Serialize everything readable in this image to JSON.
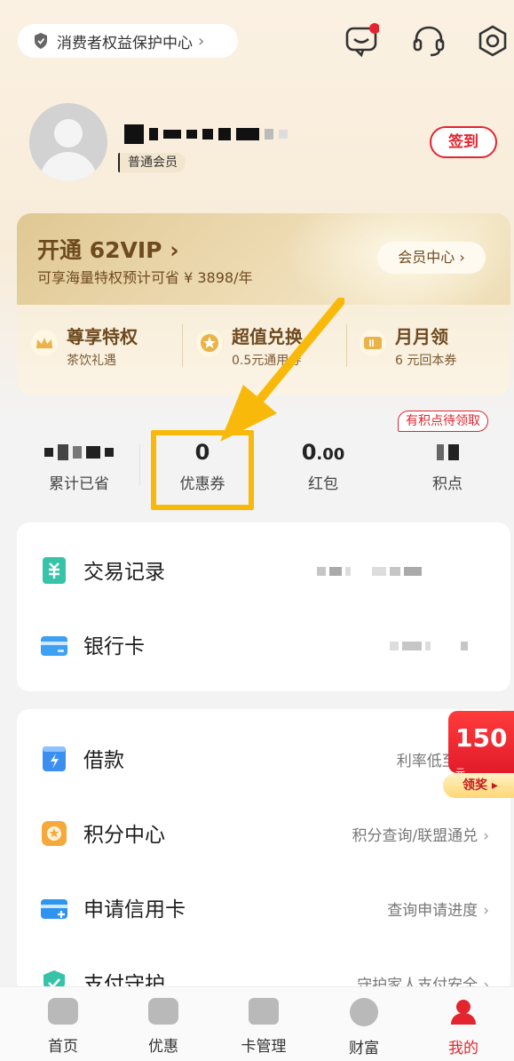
{
  "header": {
    "consumer_label": "消费者权益保护中心",
    "chevron": "›",
    "icons": [
      "message-icon",
      "headset-icon",
      "settings-icon"
    ],
    "notification_dot_color": "#e3252f"
  },
  "profile": {
    "member_level": "普通会员",
    "checkin_label": "签到"
  },
  "vip": {
    "title": "开通 62VIP",
    "title_chevron": "›",
    "subtitle": "可享海量特权预计可省 ¥ 3898/年",
    "center_button": "会员中心",
    "center_chevron": "›",
    "perks": [
      {
        "title": "尊享特权",
        "subtitle": "茶饮礼遇",
        "icon": "crown-icon"
      },
      {
        "title": "超值兑换",
        "subtitle": "0.5元通用券",
        "icon": "star-icon"
      },
      {
        "title": "月月领",
        "subtitle": "6 元回本券",
        "icon": "ticket-icon"
      }
    ]
  },
  "stats": {
    "saved_label": "累计已省",
    "coupon_value": "0",
    "coupon_label": "优惠券",
    "redpacket_value_int": "0",
    "redpacket_value_dec": ".00",
    "redpacket_label": "红包",
    "points_label": "积点",
    "points_pill": "有积点待领取"
  },
  "menu1": [
    {
      "label": "交易记录",
      "icon": "receipt-icon"
    },
    {
      "label": "银行卡",
      "icon": "bank-card-icon"
    }
  ],
  "menu2": [
    {
      "label": "借款",
      "right": "利率低至 3",
      "icon": "loan-icon"
    },
    {
      "label": "积分中心",
      "right": "积分查询/联盟通兑",
      "icon": "points-icon"
    },
    {
      "label": "申请信用卡",
      "right": "查询申请进度",
      "icon": "credit-card-icon"
    },
    {
      "label": "支付守护",
      "right": "守护家人支付安全",
      "icon": "shield-check-icon"
    }
  ],
  "promo": {
    "amount": "150",
    "unit": "元",
    "action": "领奖 ▸"
  },
  "nav": [
    {
      "label": "首页",
      "icon": "home-icon"
    },
    {
      "label": "优惠",
      "icon": "discount-icon"
    },
    {
      "label": "卡管理",
      "icon": "card-manage-icon"
    },
    {
      "label": "财富",
      "icon": "wealth-icon"
    },
    {
      "label": "我的",
      "icon": "me-icon"
    }
  ],
  "colors": {
    "accent_red": "#e3252f",
    "gold_text": "#6e4a1f",
    "highlight_yellow": "#f9b90a"
  }
}
